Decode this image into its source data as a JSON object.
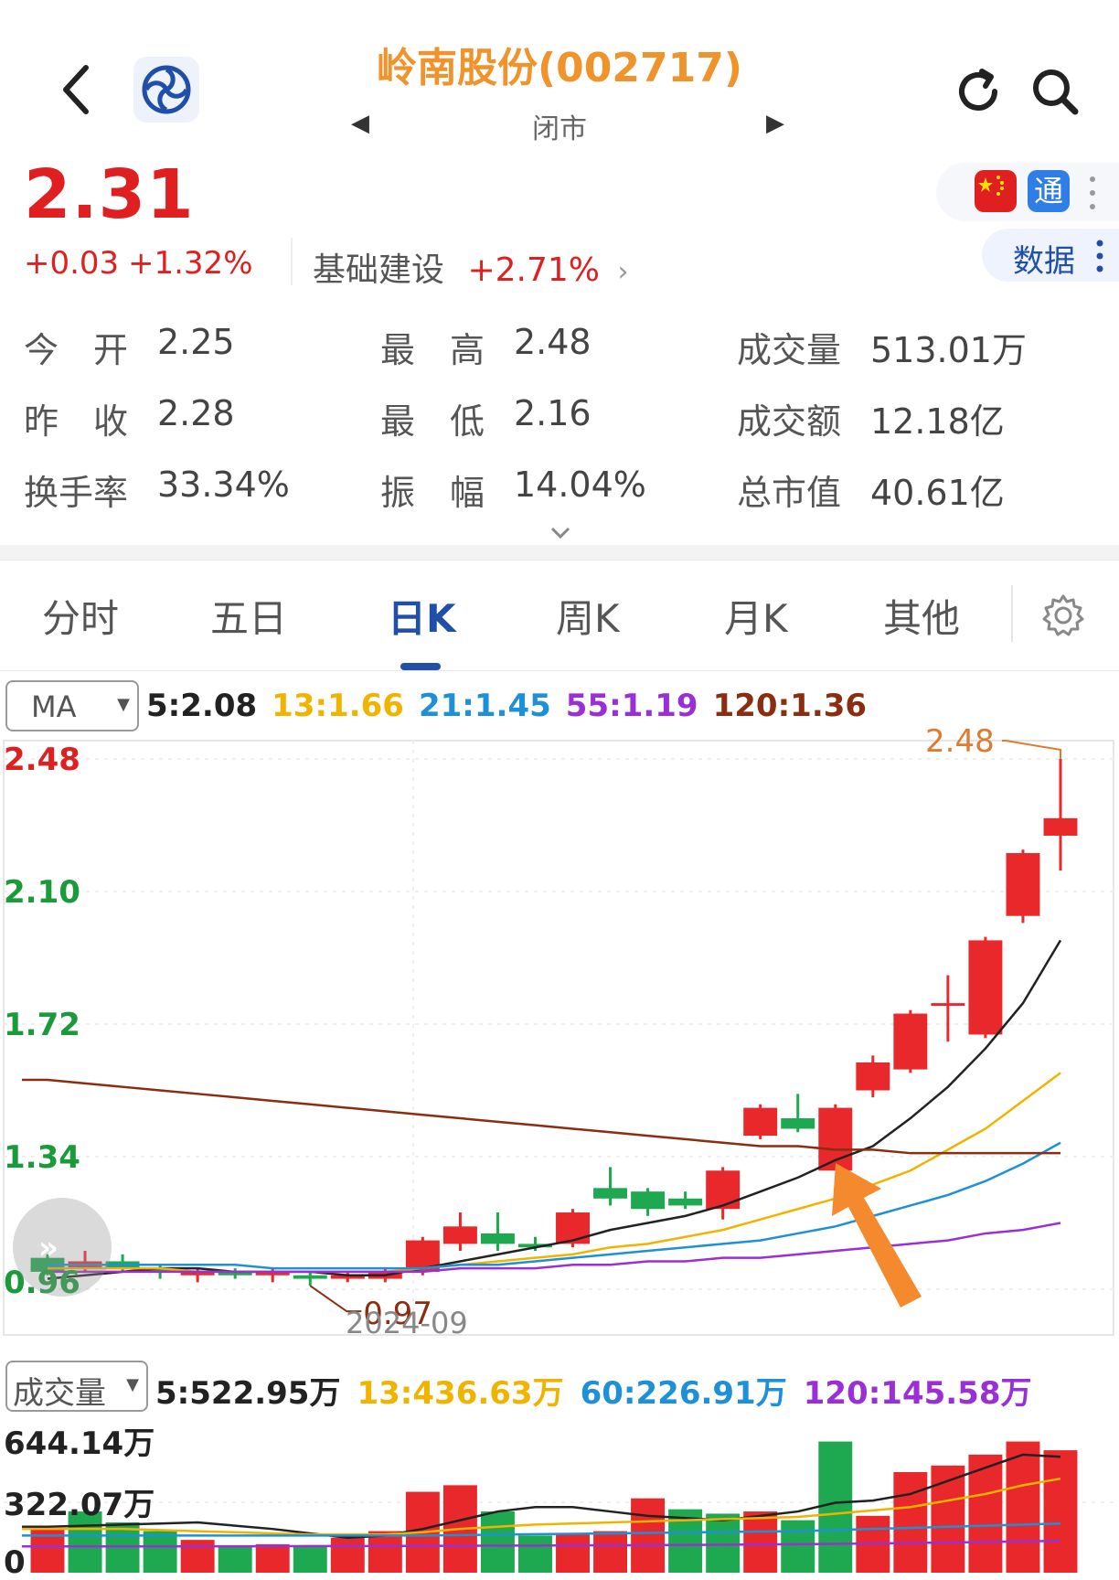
{
  "header": {
    "title": "岭南股份(002717)",
    "status": "闭市"
  },
  "quote": {
    "price": "2.31",
    "change": "+0.03",
    "change_pct": "+1.32%",
    "sector_name": "基础建设",
    "sector_pct": "+2.71%",
    "badge_tong": "通",
    "data_label": "数据"
  },
  "stats": [
    {
      "label": "今　开",
      "value": "2.25"
    },
    {
      "label": "最　高",
      "value": "2.48"
    },
    {
      "label": "成交量",
      "value": "513.01万"
    },
    {
      "label": "昨　收",
      "value": "2.28"
    },
    {
      "label": "最　低",
      "value": "2.16"
    },
    {
      "label": "成交额",
      "value": "12.18亿"
    },
    {
      "label": "换手率",
      "value": "33.34%"
    },
    {
      "label": "振　幅",
      "value": "14.04%"
    },
    {
      "label": "总市值",
      "value": "40.61亿"
    }
  ],
  "tabs": [
    {
      "label": "分时"
    },
    {
      "label": "五日"
    },
    {
      "label": "日K"
    },
    {
      "label": "周K"
    },
    {
      "label": "月K"
    },
    {
      "label": "其他"
    }
  ],
  "active_tab": 2,
  "ma_selector": "MA",
  "ma_legend": [
    {
      "text": "5:2.08",
      "color": "#222222"
    },
    {
      "text": "13:1.66",
      "color": "#f0b400"
    },
    {
      "text": "21:1.45",
      "color": "#1e90d8"
    },
    {
      "text": "55:1.19",
      "color": "#9b2fd6"
    },
    {
      "text": "120:1.36",
      "color": "#8b2d10"
    }
  ],
  "vol_selector": "成交量",
  "vol_legend": [
    {
      "text": "5:522.95万",
      "color": "#222222"
    },
    {
      "text": "13:436.63万",
      "color": "#f0b400"
    },
    {
      "text": "60:226.91万",
      "color": "#1e90d8"
    },
    {
      "text": "120:145.58万",
      "color": "#9b2fd6"
    }
  ],
  "chart_data": [
    {
      "type": "candlestick",
      "ylim": [
        0.96,
        2.48
      ],
      "y_ticks": [
        "2.48",
        "2.10",
        "1.72",
        "1.34",
        "0.96"
      ],
      "x_label": "2024-09",
      "annotations": {
        "max_label": "2.48",
        "min_label": "0.97"
      },
      "up_color": "#e8282b",
      "down_color": "#1ea84f",
      "candles": [
        {
          "o": 1.05,
          "c": 1.01,
          "h": 1.06,
          "l": 1.0
        },
        {
          "o": 1.02,
          "c": 1.04,
          "h": 1.07,
          "l": 1.01
        },
        {
          "o": 1.04,
          "c": 1.02,
          "h": 1.06,
          "l": 1.01
        },
        {
          "o": 1.02,
          "c": 1.01,
          "h": 1.03,
          "l": 0.99
        },
        {
          "o": 1.0,
          "c": 1.01,
          "h": 1.02,
          "l": 0.98
        },
        {
          "o": 1.01,
          "c": 1.0,
          "h": 1.02,
          "l": 0.99
        },
        {
          "o": 1.0,
          "c": 1.01,
          "h": 1.02,
          "l": 0.98
        },
        {
          "o": 1.0,
          "c": 0.99,
          "h": 1.01,
          "l": 0.97
        },
        {
          "o": 0.99,
          "c": 1.0,
          "h": 1.01,
          "l": 0.98
        },
        {
          "o": 0.99,
          "c": 1.01,
          "h": 1.02,
          "l": 0.98
        },
        {
          "o": 1.01,
          "c": 1.1,
          "h": 1.11,
          "l": 1.0
        },
        {
          "o": 1.09,
          "c": 1.14,
          "h": 1.18,
          "l": 1.07
        },
        {
          "o": 1.12,
          "c": 1.09,
          "h": 1.18,
          "l": 1.07
        },
        {
          "o": 1.09,
          "c": 1.08,
          "h": 1.11,
          "l": 1.07
        },
        {
          "o": 1.09,
          "c": 1.18,
          "h": 1.19,
          "l": 1.08
        },
        {
          "o": 1.25,
          "c": 1.22,
          "h": 1.31,
          "l": 1.2
        },
        {
          "o": 1.24,
          "c": 1.19,
          "h": 1.25,
          "l": 1.17
        },
        {
          "o": 1.22,
          "c": 1.2,
          "h": 1.24,
          "l": 1.19
        },
        {
          "o": 1.19,
          "c": 1.3,
          "h": 1.31,
          "l": 1.16
        },
        {
          "o": 1.4,
          "c": 1.48,
          "h": 1.49,
          "l": 1.39
        },
        {
          "o": 1.45,
          "c": 1.42,
          "h": 1.52,
          "l": 1.41
        },
        {
          "o": 1.3,
          "c": 1.48,
          "h": 1.49,
          "l": 1.3
        },
        {
          "o": 1.53,
          "c": 1.61,
          "h": 1.63,
          "l": 1.51
        },
        {
          "o": 1.59,
          "c": 1.75,
          "h": 1.76,
          "l": 1.58
        },
        {
          "o": 1.78,
          "c": 1.78,
          "h": 1.86,
          "l": 1.67
        },
        {
          "o": 1.69,
          "c": 1.96,
          "h": 1.97,
          "l": 1.68
        },
        {
          "o": 2.03,
          "c": 2.21,
          "h": 2.22,
          "l": 2.01
        },
        {
          "o": 2.26,
          "c": 2.31,
          "h": 2.48,
          "l": 2.16
        }
      ],
      "ma_lines": [
        {
          "name": "5",
          "color": "#222222",
          "values": [
            0.99,
            1.0,
            1.01,
            1.02,
            1.02,
            1.01,
            1.01,
            1.01,
            1.0,
            1.0,
            1.02,
            1.04,
            1.06,
            1.08,
            1.1,
            1.13,
            1.15,
            1.17,
            1.2,
            1.24,
            1.28,
            1.33,
            1.37,
            1.45,
            1.54,
            1.65,
            1.78,
            1.96
          ]
        },
        {
          "name": "13",
          "color": "#f0b400",
          "values": [
            1.02,
            1.02,
            1.02,
            1.02,
            1.01,
            1.01,
            1.01,
            1.01,
            1.01,
            1.01,
            1.02,
            1.03,
            1.04,
            1.05,
            1.06,
            1.08,
            1.09,
            1.11,
            1.13,
            1.16,
            1.19,
            1.22,
            1.26,
            1.3,
            1.36,
            1.42,
            1.5,
            1.58
          ]
        },
        {
          "name": "21",
          "color": "#1e90d8",
          "values": [
            1.03,
            1.03,
            1.03,
            1.03,
            1.03,
            1.03,
            1.02,
            1.02,
            1.02,
            1.02,
            1.02,
            1.03,
            1.03,
            1.04,
            1.05,
            1.06,
            1.07,
            1.08,
            1.09,
            1.1,
            1.12,
            1.14,
            1.17,
            1.2,
            1.23,
            1.27,
            1.32,
            1.38
          ]
        },
        {
          "name": "55",
          "color": "#9b2fd6",
          "values": [
            1.01,
            1.01,
            1.01,
            1.01,
            1.01,
            1.01,
            1.01,
            1.01,
            1.01,
            1.01,
            1.01,
            1.02,
            1.02,
            1.02,
            1.03,
            1.03,
            1.04,
            1.04,
            1.05,
            1.05,
            1.06,
            1.07,
            1.08,
            1.09,
            1.1,
            1.12,
            1.13,
            1.15
          ]
        },
        {
          "name": "120",
          "color": "#8b2d10",
          "values": [
            1.56,
            1.55,
            1.54,
            1.53,
            1.52,
            1.51,
            1.5,
            1.49,
            1.48,
            1.47,
            1.46,
            1.45,
            1.44,
            1.43,
            1.42,
            1.41,
            1.4,
            1.39,
            1.38,
            1.37,
            1.37,
            1.36,
            1.36,
            1.35,
            1.35,
            1.35,
            1.35,
            1.35
          ]
        }
      ]
    },
    {
      "type": "bar",
      "ylim": [
        0,
        644.14
      ],
      "y_ticks": [
        "644.14万",
        "322.07万",
        "0"
      ],
      "values": [
        200,
        280,
        230,
        190,
        150,
        120,
        130,
        120,
        160,
        190,
        370,
        400,
        280,
        170,
        180,
        190,
        340,
        290,
        270,
        280,
        240,
        600,
        260,
        460,
        490,
        540,
        600,
        560
      ],
      "bar_colors": [
        "up",
        "down",
        "down",
        "down",
        "up",
        "down",
        "up",
        "down",
        "up",
        "up",
        "up",
        "up",
        "down",
        "down",
        "up",
        "up",
        "up",
        "down",
        "down",
        "up",
        "down",
        "down",
        "up",
        "up",
        "up",
        "up",
        "up",
        "up"
      ],
      "ma_lines": [
        {
          "name": "5",
          "color": "#222222",
          "values": [
            210,
            215,
            220,
            225,
            230,
            215,
            200,
            180,
            160,
            170,
            200,
            240,
            280,
            300,
            300,
            280,
            260,
            250,
            240,
            260,
            280,
            320,
            330,
            360,
            420,
            480,
            540,
            530
          ]
        },
        {
          "name": "13",
          "color": "#f0b400",
          "values": [
            200,
            200,
            200,
            195,
            190,
            185,
            180,
            175,
            175,
            175,
            185,
            200,
            210,
            220,
            225,
            230,
            235,
            240,
            245,
            250,
            255,
            270,
            285,
            300,
            330,
            360,
            400,
            430
          ]
        },
        {
          "name": "60",
          "color": "#1e90d8",
          "values": [
            170,
            170,
            170,
            170,
            170,
            170,
            170,
            170,
            170,
            170,
            170,
            172,
            174,
            176,
            178,
            180,
            182,
            184,
            186,
            188,
            190,
            195,
            200,
            205,
            210,
            215,
            220,
            225
          ]
        },
        {
          "name": "120",
          "color": "#9b2fd6",
          "values": [
            120,
            120,
            120,
            120,
            121,
            121,
            121,
            122,
            122,
            122,
            123,
            123,
            124,
            124,
            125,
            125,
            126,
            127,
            128,
            129,
            130,
            132,
            134,
            136,
            138,
            140,
            143,
            146
          ]
        }
      ]
    }
  ]
}
